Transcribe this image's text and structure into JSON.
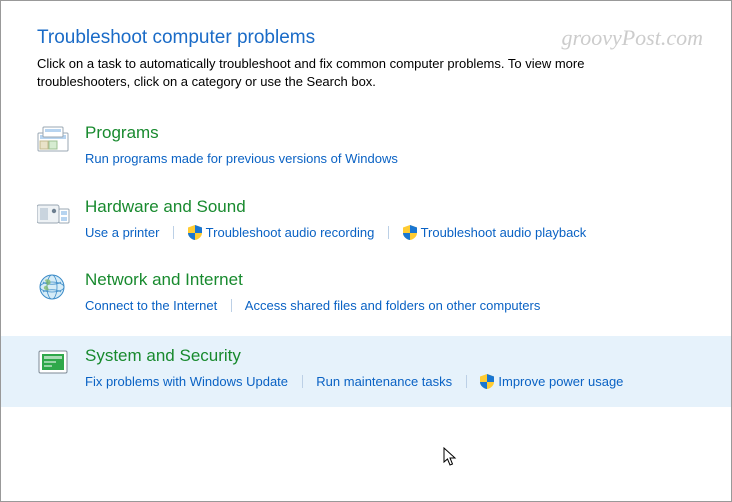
{
  "watermark": "groovyPost.com",
  "header": {
    "title": "Troubleshoot computer problems",
    "description": "Click on a task to automatically troubleshoot and fix common computer problems. To view more troubleshooters, click on a category or use the Search box."
  },
  "categories": [
    {
      "title": "Programs",
      "links": [
        {
          "label": "Run programs made for previous versions of Windows",
          "shield": false
        }
      ]
    },
    {
      "title": "Hardware and Sound",
      "links": [
        {
          "label": "Use a printer",
          "shield": false
        },
        {
          "label": "Troubleshoot audio recording",
          "shield": true
        },
        {
          "label": "Troubleshoot audio playback",
          "shield": true
        }
      ]
    },
    {
      "title": "Network and Internet",
      "links": [
        {
          "label": "Connect to the Internet",
          "shield": false
        },
        {
          "label": "Access shared files and folders on other computers",
          "shield": false
        }
      ]
    },
    {
      "title": "System and Security",
      "highlight": true,
      "links": [
        {
          "label": "Fix problems with Windows Update",
          "shield": false
        },
        {
          "label": "Run maintenance tasks",
          "shield": false
        },
        {
          "label": "Improve power usage",
          "shield": true
        }
      ]
    }
  ]
}
